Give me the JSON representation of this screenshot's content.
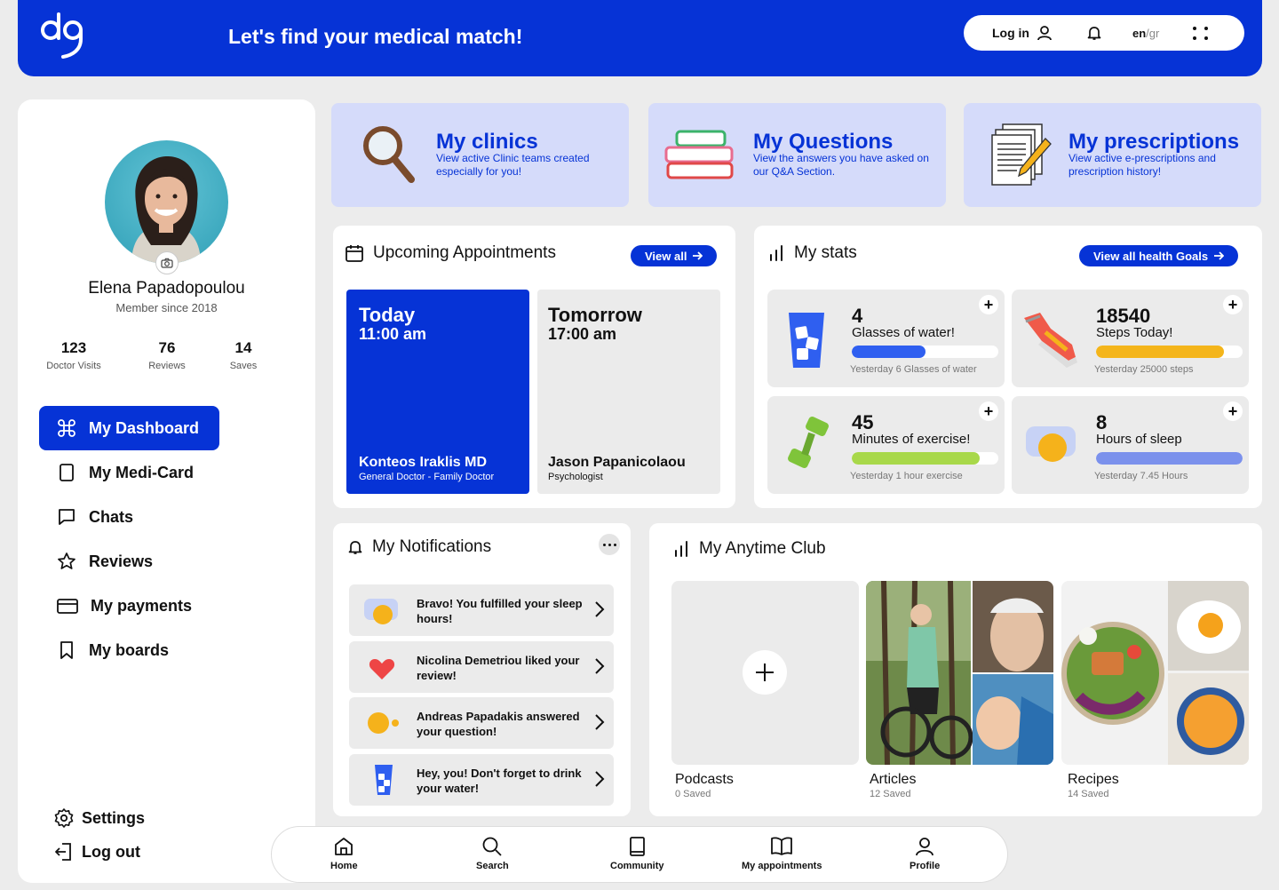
{
  "header": {
    "tagline": "Let's find your medical match!",
    "login_label": "Log in",
    "lang_en": "en",
    "lang_sep": "/",
    "lang_gr": "gr"
  },
  "profile": {
    "name": "Elena Papadopoulou",
    "member_since": "Member since 2018",
    "stats": [
      {
        "value": "123",
        "label": "Doctor Visits"
      },
      {
        "value": "76",
        "label": "Reviews"
      },
      {
        "value": "14",
        "label": "Saves"
      }
    ]
  },
  "nav": {
    "items": [
      {
        "label": "My Dashboard"
      },
      {
        "label": "My Medi-Card"
      },
      {
        "label": "Chats"
      },
      {
        "label": "Reviews"
      },
      {
        "label": "My payments"
      },
      {
        "label": "My boards"
      }
    ],
    "settings": "Settings",
    "logout": "Log out"
  },
  "top_cards": [
    {
      "title": "My clinics",
      "desc": "View active Clinic teams created especially for you!"
    },
    {
      "title": "My Questions",
      "desc": "View the answers you have asked on our Q&A Section."
    },
    {
      "title": "My prescriptions",
      "desc": "View active e-prescriptions and prescription history!"
    }
  ],
  "appointments": {
    "title": "Upcoming Appointments",
    "view_all": "View all",
    "items": [
      {
        "day": "Today",
        "time": "11:00 am",
        "doctor": "Konteos Iraklis MD",
        "specialty": "General Doctor - Family Doctor"
      },
      {
        "day": "Tomorrow",
        "time": "17:00 am",
        "doctor": "Jason Papanicolaou",
        "specialty": "Psychologist"
      }
    ]
  },
  "stats": {
    "title": "My stats",
    "view_all": "View all health Goals",
    "items": [
      {
        "value": "4",
        "label": "Glasses of water!",
        "progress": 0.5,
        "color": "#2f5ff0",
        "sub": "Yesterday 6 Glasses of water"
      },
      {
        "value": "18540",
        "label": "Steps Today!",
        "progress": 0.87,
        "color": "#f4b51b",
        "sub": "Yesterday 25000 steps"
      },
      {
        "value": "45",
        "label": "Minutes of exercise!",
        "progress": 0.87,
        "color": "#a8d84a",
        "sub": "Yesterday 1 hour exercise"
      },
      {
        "value": "8",
        "label": "Hours of sleep",
        "progress": 1.0,
        "color": "#7b91ec",
        "sub": "Yesterday 7.45 Hours"
      }
    ]
  },
  "notifications": {
    "title": "My Notifications",
    "items": [
      {
        "text": "Bravo! You fulfilled your sleep hours!"
      },
      {
        "text": "Nicolina Demetriou liked your review!"
      },
      {
        "text": "Andreas Papadakis answered your question!"
      },
      {
        "text": "Hey, you! Don't forget to drink your water!"
      }
    ]
  },
  "club": {
    "title": "My Anytime Club",
    "tiles": [
      {
        "name": "Podcasts",
        "sub": "0 Saved"
      },
      {
        "name": "Articles",
        "sub": "12 Saved"
      },
      {
        "name": "Recipes",
        "sub": "14 Saved"
      }
    ]
  },
  "tabbar": {
    "items": [
      {
        "label": "Home"
      },
      {
        "label": "Search"
      },
      {
        "label": "Community"
      },
      {
        "label": "My appointments"
      },
      {
        "label": "Profile"
      }
    ]
  },
  "colors": {
    "brand": "#0633d6",
    "card_bg": "#d5dbfa"
  }
}
